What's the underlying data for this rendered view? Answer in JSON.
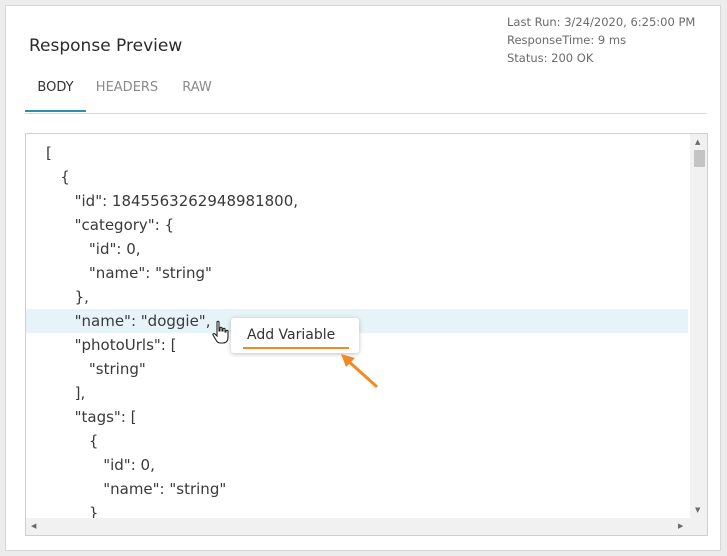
{
  "panel": {
    "title": "Response Preview",
    "last_run": "Last Run: 3/24/2020, 6:25:00 PM",
    "response_time": "ResponseTime: 9 ms",
    "status": "Status: 200 OK"
  },
  "tabs": [
    {
      "label": "BODY",
      "active": true
    },
    {
      "label": "HEADERS",
      "active": false
    },
    {
      "label": "RAW",
      "active": false
    }
  ],
  "code_lines": [
    "[",
    "   {",
    "      \"id\": 1845563262948981800,",
    "      \"category\": {",
    "         \"id\": 0,",
    "         \"name\": \"string\"",
    "      },",
    "      \"name\": \"doggie\",",
    "      \"photoUrls\": [",
    "         \"string\"",
    "      ],",
    "      \"tags\": [",
    "         {",
    "            \"id\": 0,",
    "            \"name\": \"string\"",
    "         }"
  ],
  "highlighted_line": 7,
  "context_action": {
    "label": "Add Variable"
  },
  "colors": {
    "accent": "#2e8db3",
    "highlight": "#e6f4fa",
    "annotation": "#f08a24"
  }
}
